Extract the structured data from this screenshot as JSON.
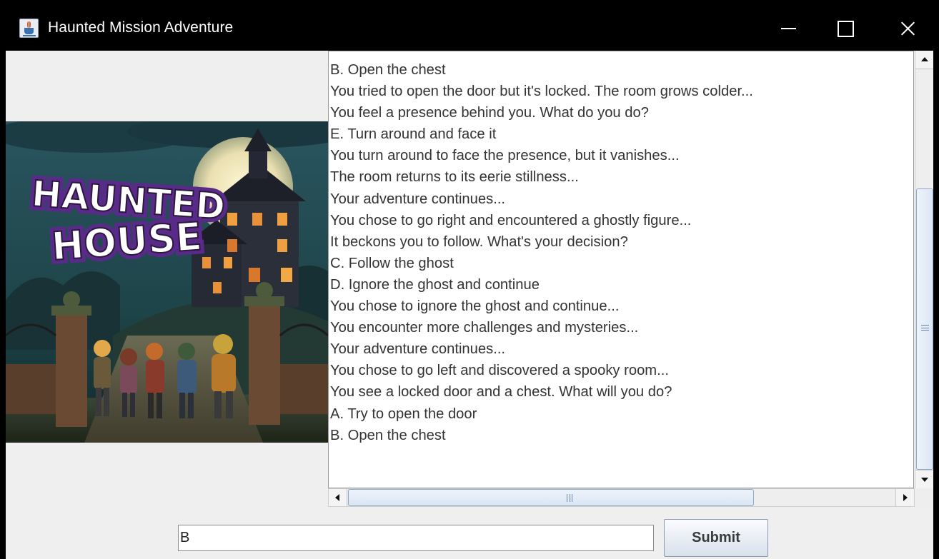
{
  "window": {
    "title": "Haunted Mission Adventure",
    "controls": [
      "minimize",
      "maximize",
      "close"
    ]
  },
  "hero_image": {
    "logo_text_line1": "HAUNTED",
    "logo_text_line2": "HOUSE",
    "icon": "haunted-house-artwork"
  },
  "story": {
    "lines": [
      "B. Open the chest",
      "You tried to open the door but it's locked. The room grows colder...",
      "You feel a presence behind you. What do you do?",
      "E. Turn around and face it",
      "You turn around to face the presence, but it vanishes...",
      "The room returns to its eerie stillness...",
      "Your adventure continues...",
      "You chose to go right and encountered a ghostly figure...",
      "It beckons you to follow. What's your decision?",
      "C. Follow the ghost",
      "D. Ignore the ghost and continue",
      "You chose to ignore the ghost and continue...",
      "You encounter more challenges and mysteries...",
      "Your adventure continues...",
      "You chose to go left and discovered a spooky room...",
      "You see a locked door and a chest. What will you do?",
      "A. Try to open the door",
      "B. Open the chest"
    ]
  },
  "input": {
    "value": "B"
  },
  "submit": {
    "label": "Submit"
  },
  "colors": {
    "titlebar": "#000000",
    "window_bg": "#efefef",
    "text": "#333333",
    "scroll_thumb_border": "#8ea8cc"
  }
}
